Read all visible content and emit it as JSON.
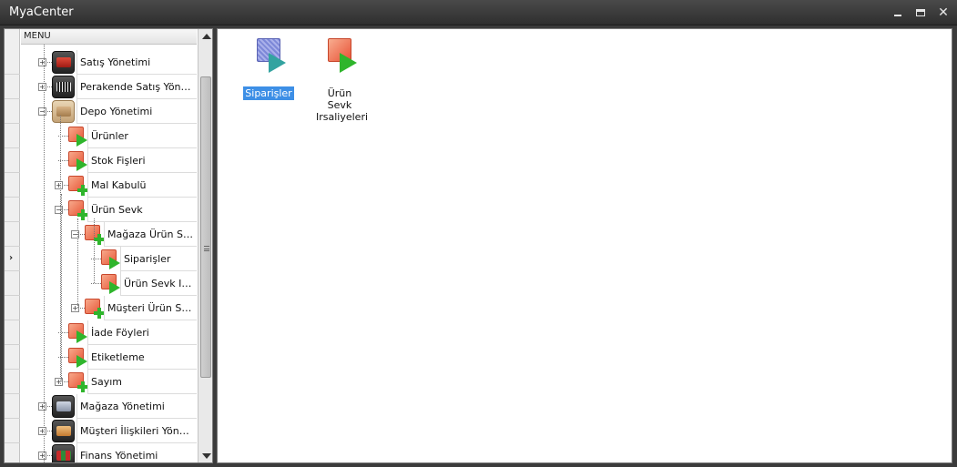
{
  "window": {
    "title": "MyaCenter",
    "controls": {
      "minimize": "minimize",
      "maximize": "maximize",
      "close": "close"
    }
  },
  "menu": {
    "header": "MENU",
    "current_row_indicator": "›",
    "items": [
      {
        "label": "Satış Yönetimi",
        "level": 0,
        "icon": "sales-truck-icon",
        "expander": "+"
      },
      {
        "label": "Perakende Satış Yönetimi",
        "level": 0,
        "icon": "barcode-icon",
        "expander": "+"
      },
      {
        "label": "Depo Yönetimi",
        "level": 0,
        "icon": "warehouse-box-icon",
        "expander": "−"
      },
      {
        "label": "Ürünler",
        "level": 1,
        "icon": "form-play-icon"
      },
      {
        "label": "Stok Fişleri",
        "level": 1,
        "icon": "form-play-icon"
      },
      {
        "label": "Mal Kabulü",
        "level": 1,
        "icon": "form-plus-icon",
        "expander": "+"
      },
      {
        "label": "Ürün Sevk",
        "level": 1,
        "icon": "form-plus-icon",
        "expander": "−"
      },
      {
        "label": "Mağaza Ürün Sevk",
        "level": 2,
        "icon": "form-plus-icon",
        "expander": "−"
      },
      {
        "label": "Siparişler",
        "level": 3,
        "icon": "form-play-icon"
      },
      {
        "label": "Ürün Sevk Irsaliyeleri",
        "level": 3,
        "icon": "form-play-icon"
      },
      {
        "label": "Müşteri Ürün Sevk",
        "level": 2,
        "icon": "form-plus-icon",
        "expander": "+"
      },
      {
        "label": "İade Föyleri",
        "level": 1,
        "icon": "form-play-icon"
      },
      {
        "label": "Etiketleme",
        "level": 1,
        "icon": "form-play-icon"
      },
      {
        "label": "Sayım",
        "level": 1,
        "icon": "form-plus-icon",
        "expander": "+"
      },
      {
        "label": "Mağaza Yönetimi",
        "level": 0,
        "icon": "store-icon",
        "expander": "+"
      },
      {
        "label": "Müşteri İlişkileri Yönetimi",
        "level": 0,
        "icon": "customer-icon",
        "expander": "+"
      },
      {
        "label": "Finans Yönetimi",
        "level": 0,
        "icon": "finance-binders-icon",
        "expander": "+"
      }
    ]
  },
  "content": {
    "tiles": [
      {
        "label": "Siparişler",
        "icon": "blue-form-play-icon",
        "selected": true
      },
      {
        "label": "Ürün Sevk Irsaliyeleri",
        "icon": "orange-form-play-icon",
        "selected": false
      }
    ]
  },
  "colors": {
    "title_bar": "#3b3b3b",
    "selection": "#3d8fe6",
    "form_icon": "#e8593a",
    "play_green": "#2fb52c"
  }
}
